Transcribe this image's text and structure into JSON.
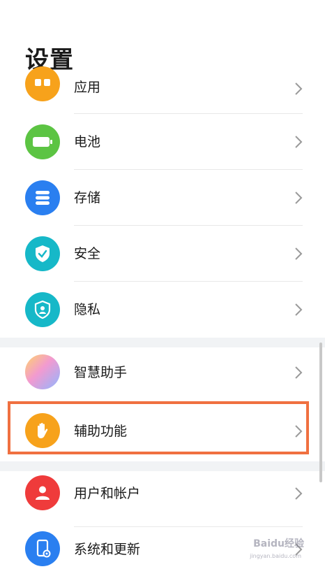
{
  "page": {
    "title": "设置"
  },
  "items": [
    {
      "label": "应用",
      "icon": "apps-icon",
      "color": "#f7a21b"
    },
    {
      "label": "电池",
      "icon": "battery-icon",
      "color": "#5cc443"
    },
    {
      "label": "存储",
      "icon": "storage-icon",
      "color": "#2a7ff0"
    },
    {
      "label": "安全",
      "icon": "shield-check-icon",
      "color": "#16b8c8"
    },
    {
      "label": "隐私",
      "icon": "privacy-icon",
      "color": "#16b8c8"
    },
    {
      "label": "智慧助手",
      "icon": "assistant-icon",
      "color": "#e39ad6"
    },
    {
      "label": "辅助功能",
      "icon": "hand-icon",
      "color": "#f7a21b"
    },
    {
      "label": "用户和帐户",
      "icon": "user-icon",
      "color": "#ef3b3b"
    },
    {
      "label": "系统和更新",
      "icon": "system-update-icon",
      "color": "#2a7ff0"
    }
  ],
  "watermark": {
    "text": "Baidu经验",
    "sub": "jingyan.baidu.com"
  }
}
